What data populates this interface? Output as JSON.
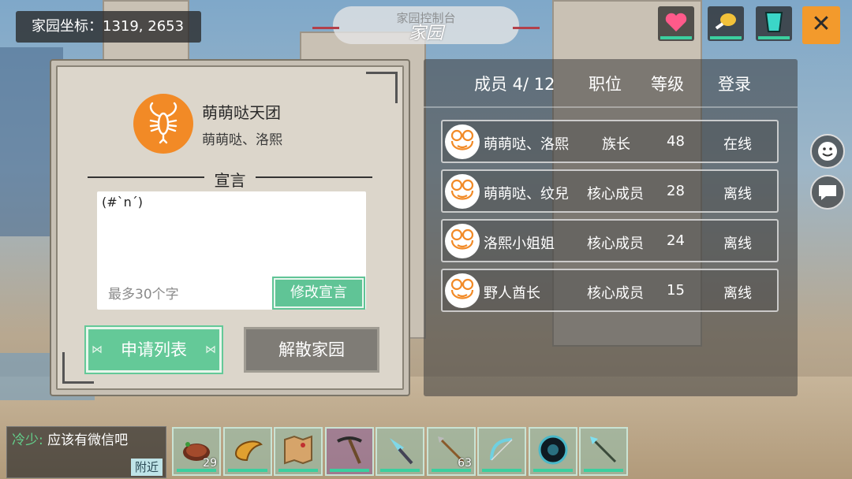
{
  "top": {
    "coords_label": "家园坐标：1319, 2653",
    "title_sub": "家园控制台",
    "title_main": "家园",
    "stats": [
      {
        "icon": "heart-icon",
        "color": "#ff5a8a"
      },
      {
        "icon": "drumstick-icon",
        "color": "#f2c23a"
      },
      {
        "icon": "water-cup-icon",
        "color": "#3bd6c8"
      }
    ],
    "close_glyph": "✕"
  },
  "team": {
    "name": "萌萌哒天团",
    "leaders": "萌萌哒、洛熙",
    "icon": "lobster-icon",
    "declaration_title": "宣言",
    "declaration_text": "(#`n´)",
    "declaration_placeholder": "最多30个字",
    "edit_label": "修改宣言",
    "apply_label": "申请列表",
    "disband_label": "解散家园"
  },
  "members": {
    "headers": {
      "members": "成员 4/ 12",
      "role": "职位",
      "level": "等级",
      "login": "登录"
    },
    "rows": [
      {
        "name": "萌萌哒、洛熙",
        "role": "族长",
        "level": "48",
        "status": "在线"
      },
      {
        "name": "萌萌哒、纹兒",
        "role": "核心成员",
        "level": "28",
        "status": "离线"
      },
      {
        "name": "洛熙小姐姐",
        "role": "核心成员",
        "level": "24",
        "status": "离线"
      },
      {
        "name": "野人酋长",
        "role": "核心成员",
        "level": "15",
        "status": "离线"
      }
    ]
  },
  "chat": {
    "sender": "冷少",
    "separator": ":",
    "message": "应该有微信吧",
    "nearby_label": "附近"
  },
  "hotbar": [
    {
      "icon": "steak-icon",
      "count": "29"
    },
    {
      "icon": "horn-icon",
      "count": ""
    },
    {
      "icon": "map-icon",
      "count": ""
    },
    {
      "icon": "pickaxe-icon",
      "count": ""
    },
    {
      "icon": "crystal-axe-icon",
      "count": ""
    },
    {
      "icon": "spear-icon",
      "count": "63"
    },
    {
      "icon": "bow-icon",
      "count": ""
    },
    {
      "icon": "orb-icon",
      "count": ""
    },
    {
      "icon": "crystal-spear-icon",
      "count": ""
    }
  ]
}
